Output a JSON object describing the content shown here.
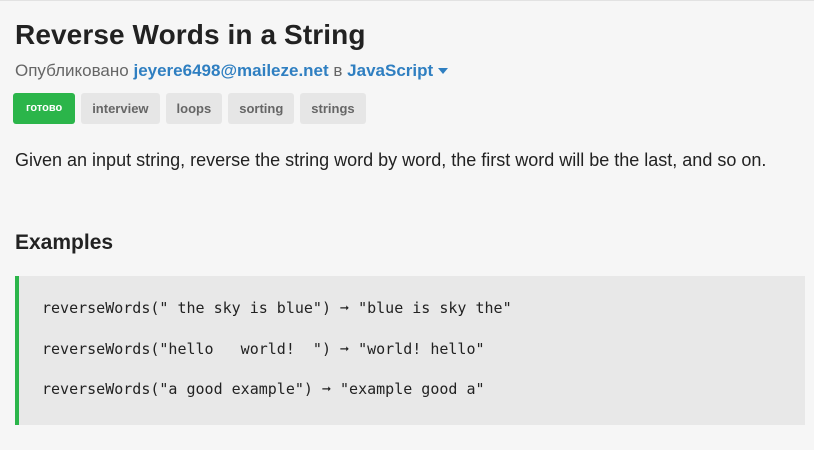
{
  "kata": {
    "title": "Reverse Words in a String",
    "published_prefix": "Опубликовано",
    "author": "jeyere6498@maileze.net",
    "in_word": "в",
    "language": "JavaScript",
    "status_label": "готово",
    "tags": [
      "interview",
      "loops",
      "sorting",
      "strings"
    ],
    "description": "Given an input string, reverse the string word by word, the first word will be the last, and so on."
  },
  "examples": {
    "heading": "Examples",
    "lines": [
      "reverseWords(\" the sky is blue\") ➞ \"blue is sky the\"",
      "reverseWords(\"hello   world!  \") ➞ \"world! hello\"",
      "reverseWords(\"a good example\") ➞ \"example good a\""
    ]
  },
  "colors": {
    "accent_green": "#2bb54a",
    "link_blue": "#2f7fc1"
  },
  "icons": {
    "language_dropdown": "chevron-down-icon"
  }
}
